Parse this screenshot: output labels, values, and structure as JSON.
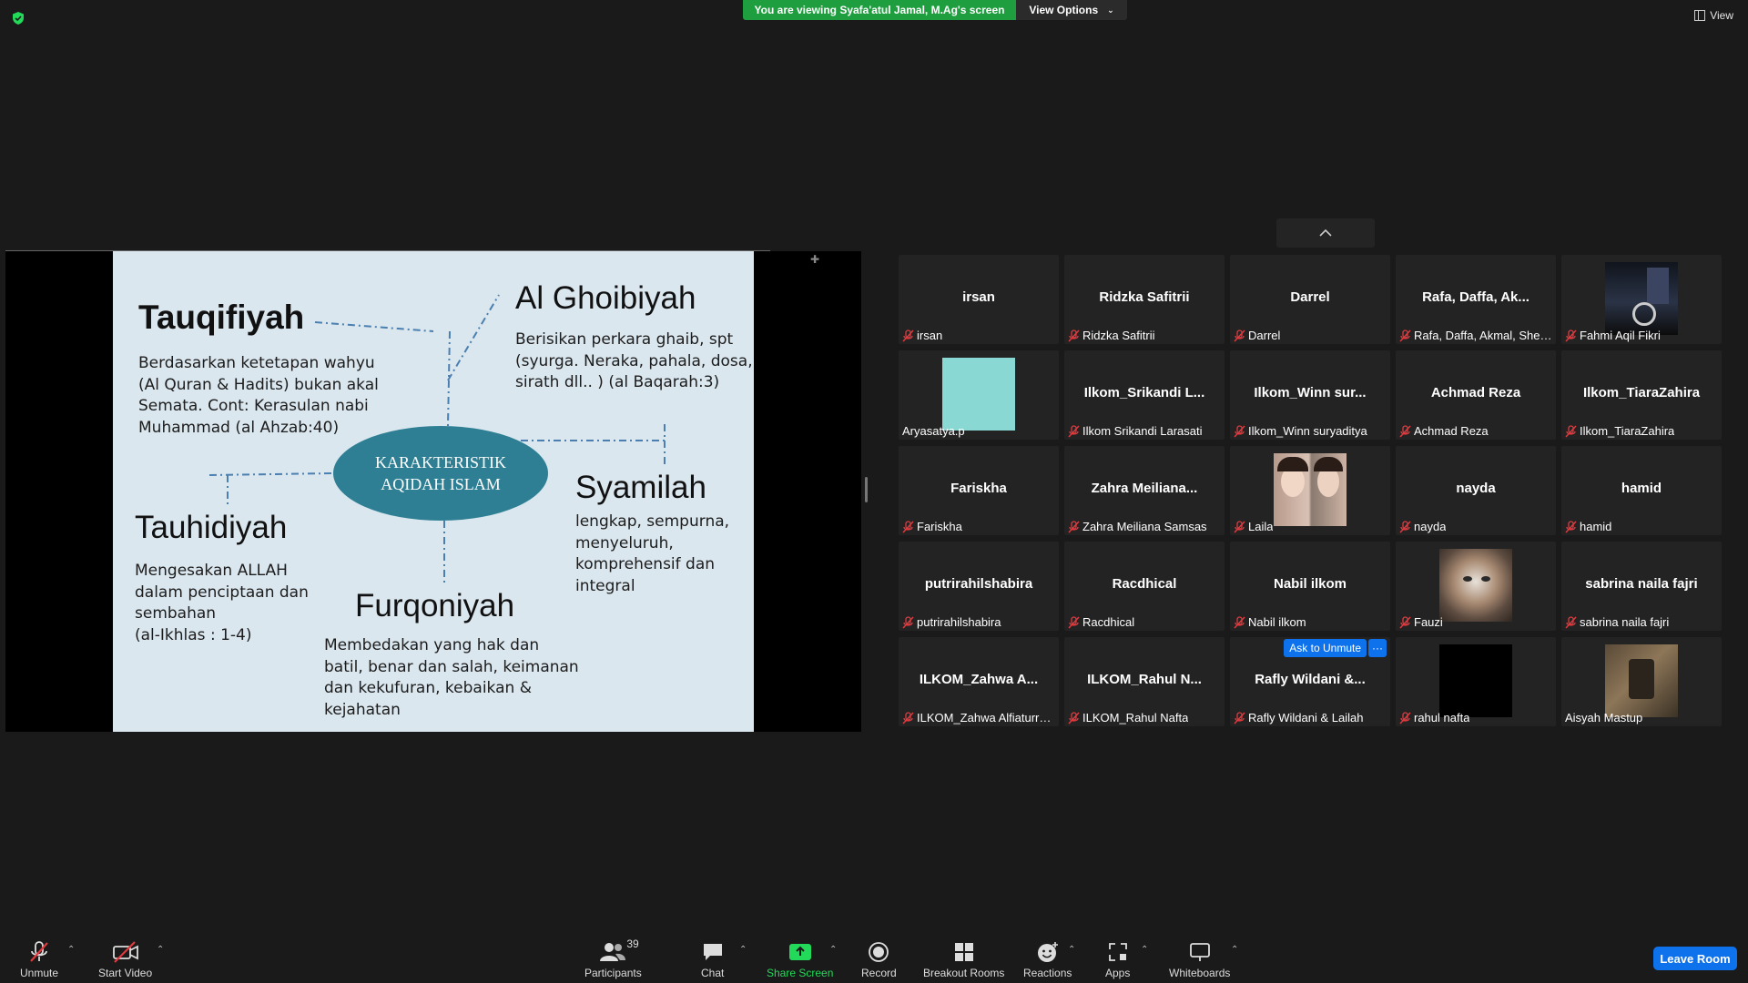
{
  "topbar": {
    "viewing_banner": "You are viewing Syafa'atul Jamal, M.Ag's screen",
    "view_options": "View Options",
    "view": "View"
  },
  "slide": {
    "center": [
      "KARAKTERISTIK",
      "AQIDAH ISLAM"
    ],
    "sections": {
      "tauqifiyah": {
        "title": "Tauqifiyah",
        "lines": [
          "Berdasarkan ketetapan wahyu",
          "(Al Quran & Hadits) bukan akal",
          "Semata. Cont: Kerasulan nabi",
          "Muhammad  (al Ahzab:40)"
        ]
      },
      "alghoibiyah": {
        "title": "Al Ghoibiyah",
        "lines": [
          "Berisikan perkara ghaib, spt",
          "(syurga. Neraka, pahala, dosa,",
          "sirath dll.. ) (al Baqarah:3)"
        ]
      },
      "syamilah": {
        "title": "Syamilah",
        "lines": [
          "lengkap, sempurna,",
          "menyeluruh,",
          "komprehensif dan",
          "integral"
        ]
      },
      "tauhidiyah": {
        "title": "Tauhidiyah",
        "lines": [
          "Mengesakan ALLAH",
          "dalam penciptaan dan",
          "sembahan",
          "(al-Ikhlas : 1-4)"
        ]
      },
      "furqoniyah": {
        "title": "Furqoniyah",
        "lines": [
          "Membedakan yang hak dan",
          "batil, benar dan salah, keimanan",
          "dan kekufuran, kebaikan &",
          "kejahatan"
        ]
      }
    }
  },
  "participants": [
    {
      "name": "irsan",
      "label": "irsan",
      "muted": true,
      "video": "none"
    },
    {
      "name": "Ridzka Safitrii",
      "label": "Ridzka Safitrii",
      "muted": true,
      "video": "none"
    },
    {
      "name": "Darrel",
      "label": "Darrel",
      "muted": true,
      "video": "none"
    },
    {
      "name": "Rafa, Daffa, Ak...",
      "label": "Rafa, Daffa, Akmal, Sheira",
      "muted": true,
      "video": "none"
    },
    {
      "name": "",
      "label": "Fahmi Aqil Fikri",
      "muted": true,
      "video": "night-photo"
    },
    {
      "name": "",
      "label": "Aryasatya.p",
      "muted": false,
      "video": "teal-square",
      "color": "#8ad8d4"
    },
    {
      "name": "Ilkom_Srikandi  L...",
      "label": "Ilkom Srikandi Larasati",
      "muted": true,
      "video": "none"
    },
    {
      "name": "Ilkom_Winn  sur...",
      "label": "Ilkom_Winn suryaditya",
      "muted": true,
      "video": "none"
    },
    {
      "name": "Achmad Reza",
      "label": "Achmad Reza",
      "muted": true,
      "video": "none"
    },
    {
      "name": "Ilkom_TiaraZahira",
      "label": "Ilkom_TiaraZahira",
      "muted": true,
      "video": "none"
    },
    {
      "name": "Fariskha",
      "label": "Fariskha",
      "muted": true,
      "video": "none"
    },
    {
      "name": "Zahra  Meiliana...",
      "label": "Zahra Meiliana Samsas",
      "muted": true,
      "video": "none"
    },
    {
      "name": "",
      "label": "Laila",
      "muted": true,
      "video": "selfie-photo"
    },
    {
      "name": "nayda",
      "label": "nayda",
      "muted": true,
      "video": "none"
    },
    {
      "name": "hamid",
      "label": "hamid",
      "muted": true,
      "video": "none"
    },
    {
      "name": "putrirahilshabira",
      "label": "putrirahilshabira",
      "muted": true,
      "video": "none"
    },
    {
      "name": "Racdhical",
      "label": "Racdhical",
      "muted": true,
      "video": "none"
    },
    {
      "name": "Nabil ilkom",
      "label": "Nabil ilkom",
      "muted": true,
      "video": "none"
    },
    {
      "name": "",
      "label": "Fauzi",
      "muted": true,
      "video": "cat-photo"
    },
    {
      "name": "sabrina naila fajri",
      "label": "sabrina naila fajri",
      "muted": true,
      "video": "none"
    },
    {
      "name": "ILKOM_Zahwa  A...",
      "label": "ILKOM_Zahwa Alfiaturro...",
      "muted": true,
      "video": "none"
    },
    {
      "name": "ILKOM_Rahul  N...",
      "label": "ILKOM_Rahul Nafta",
      "muted": true,
      "video": "none"
    },
    {
      "name": "Rafly  Wildani  &...",
      "label": "Rafly Wildani & Lailah",
      "muted": true,
      "video": "none",
      "ask_unmute": "Ask to Unmute",
      "more": "···"
    },
    {
      "name": "",
      "label": "rahul nafta",
      "muted": true,
      "video": "black-square",
      "color": "#000000"
    },
    {
      "name": "",
      "label": "Aisyah Mastup",
      "muted": false,
      "video": "room-photo"
    }
  ],
  "toolbar": {
    "unmute": "Unmute",
    "start_video": "Start Video",
    "participants": "Participants",
    "participants_count": "39",
    "chat": "Chat",
    "share_screen": "Share Screen",
    "record": "Record",
    "breakout_rooms": "Breakout Rooms",
    "reactions": "Reactions",
    "apps": "Apps",
    "whiteboards": "Whiteboards",
    "leave_room": "Leave Room"
  },
  "colors": {
    "share_accent": "#23d959",
    "leave_blue": "#0e72ed",
    "banner_green": "#1f9e3f",
    "mic_off_red": "#e0393e"
  }
}
